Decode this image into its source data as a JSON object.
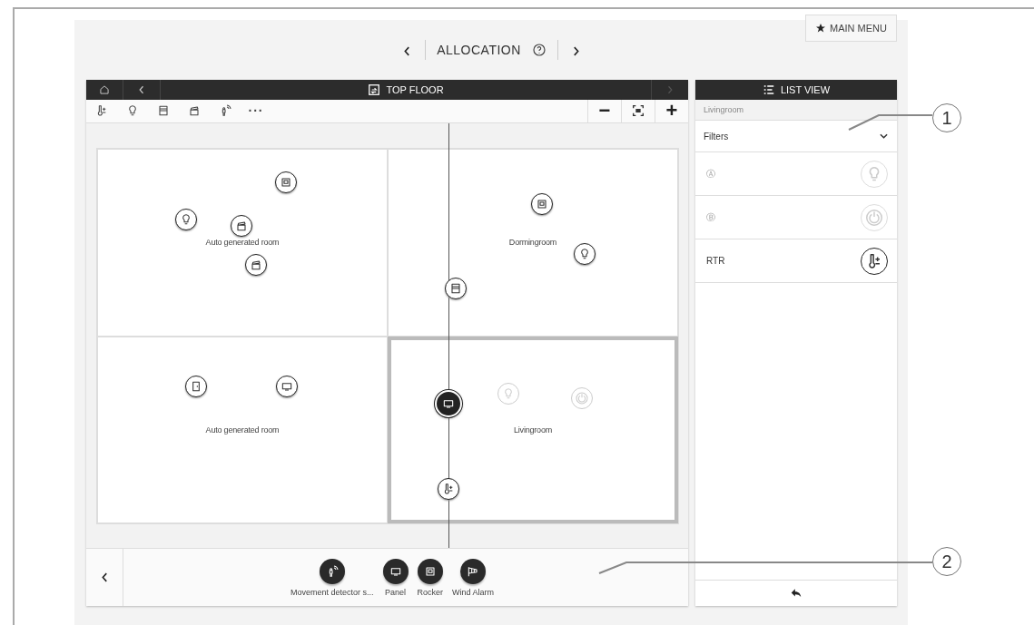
{
  "header": {
    "title": "ALLOCATION",
    "main_menu": "MAIN MENU"
  },
  "floor": {
    "title": "TOP FLOOR"
  },
  "toolbar": {
    "tools": [
      {
        "kind": "thermostat"
      },
      {
        "kind": "light"
      },
      {
        "kind": "shutter"
      },
      {
        "kind": "blind"
      },
      {
        "kind": "movement"
      },
      {
        "kind": "more",
        "label": "···"
      }
    ],
    "zoom_out": "−",
    "zoom_in": "+"
  },
  "rooms": [
    {
      "name": "Auto generated room",
      "selected": false
    },
    {
      "name": "Dormingroom",
      "selected": false
    },
    {
      "name": "Auto generated room",
      "selected": false
    },
    {
      "name": "Livingroom",
      "selected": true
    }
  ],
  "devices": [
    {
      "kind": "rocker",
      "selected": false,
      "faded": false
    },
    {
      "kind": "light",
      "selected": false,
      "faded": false
    },
    {
      "kind": "blind",
      "selected": false,
      "faded": false
    },
    {
      "kind": "blind",
      "selected": false,
      "faded": false
    },
    {
      "kind": "rocker",
      "selected": false,
      "faded": false
    },
    {
      "kind": "light",
      "selected": false,
      "faded": false
    },
    {
      "kind": "shutter",
      "selected": false,
      "faded": false
    },
    {
      "kind": "door",
      "selected": false,
      "faded": false
    },
    {
      "kind": "panel",
      "selected": false,
      "faded": false
    },
    {
      "kind": "panel",
      "selected": true,
      "faded": false
    },
    {
      "kind": "light",
      "selected": false,
      "faded": true
    },
    {
      "kind": "power",
      "selected": false,
      "faded": true
    },
    {
      "kind": "thermostat",
      "selected": false,
      "faded": false
    }
  ],
  "palette": [
    {
      "label": "Movement detector s...",
      "kind": "movement"
    },
    {
      "label": "Panel",
      "kind": "panel"
    },
    {
      "label": "Rocker",
      "kind": "rocker"
    },
    {
      "label": "Wind Alarm",
      "kind": "wind"
    }
  ],
  "list_view": {
    "title": "LIST VIEW",
    "room": "Livingroom",
    "filter": "Filters",
    "items": [
      {
        "label": "Ⓐ",
        "kind": "light",
        "faded": true
      },
      {
        "label": "Ⓑ",
        "kind": "power",
        "faded": true
      },
      {
        "label": "RTR",
        "kind": "thermostat",
        "faded": false
      }
    ]
  },
  "callouts": [
    "1",
    "2"
  ]
}
